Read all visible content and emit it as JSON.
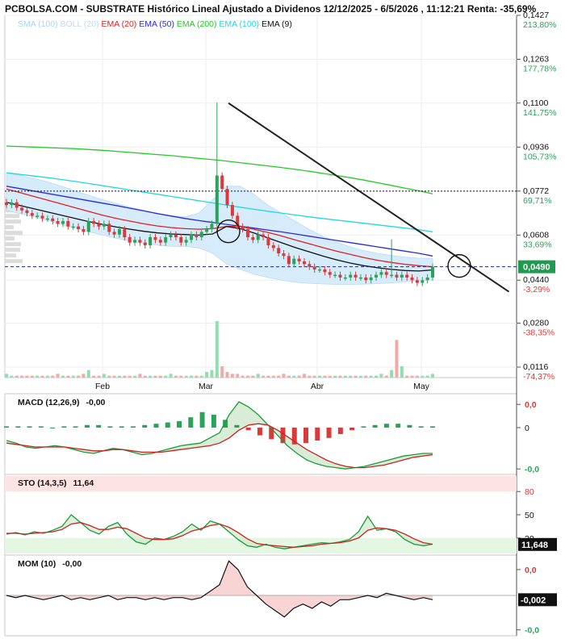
{
  "header": {
    "title": "PCBOLSA.COM - SUBSTRATE Histórico Lineal Ajustado a Dividenos 12/12/2025 - 6/5/2026 , 11:12:21 Renta: -35,69%"
  },
  "legend": [
    {
      "label": "SMA (100)",
      "color": "#a9d3f0"
    },
    {
      "label": "BOLL (20)",
      "color": "#c8d6e2"
    },
    {
      "label": "EMA (20)",
      "color": "#e02020"
    },
    {
      "label": "EMA (50)",
      "color": "#2b2bd6"
    },
    {
      "label": "EMA (200)",
      "color": "#22cc22"
    },
    {
      "label": "EMA (100)",
      "color": "#22d8e0"
    },
    {
      "label": "EMA (9)",
      "color": "#111111"
    }
  ],
  "colors": {
    "up": "#2aa35a",
    "down": "#d93a3a",
    "volume_up": "#8fe0b0",
    "volume_down": "#f4a9a9",
    "boll_fill": "#d6ecfb",
    "trendline": "#222222",
    "pct_positive": "#2aa35a",
    "pct_negative": "#d93a3a",
    "current_badge": "#1f9a4f"
  },
  "chart_data": [
    {
      "type": "candlestick",
      "title": "PCBOLSA.COM - SUBSTRATE Histórico Lineal Ajustado a Dividenos 12/12/2025 - 6/5/2026 , 11:12:21 Renta: -35,69%",
      "y_ticks": [
        {
          "price": "0,1427",
          "pct": "213,80%"
        },
        {
          "price": "0,1263",
          "pct": "177,78%"
        },
        {
          "price": "0,1100",
          "pct": "141,75%"
        },
        {
          "price": "0,0936",
          "pct": "105,73%"
        },
        {
          "price": "0,0772",
          "pct": "69,71%"
        },
        {
          "price": "0,0608",
          "pct": "33,69%"
        },
        {
          "price": "0,0440",
          "pct": "-3,29%"
        },
        {
          "price": "0,0280",
          "pct": "-38,35%"
        },
        {
          "price": "0,0116",
          "pct": "-74,37%"
        }
      ],
      "ylim": [
        0.0116,
        0.1427
      ],
      "x_labels": [
        "Feb",
        "Mar",
        "Abr",
        "May"
      ],
      "current_price": "0,0490",
      "reference_line": 0.0772,
      "trendline": [
        {
          "x": 0.437,
          "y": 0.11
        },
        {
          "x": 0.985,
          "y": 0.0397
        }
      ],
      "highlight_circles": [
        {
          "x": 0.437,
          "y": 0.0622
        },
        {
          "x": 0.888,
          "y": 0.0493
        }
      ],
      "close": [
        0.072,
        0.073,
        0.071,
        0.07,
        0.069,
        0.068,
        0.068,
        0.067,
        0.067,
        0.066,
        0.065,
        0.066,
        0.064,
        0.064,
        0.063,
        0.062,
        0.066,
        0.065,
        0.064,
        0.065,
        0.062,
        0.061,
        0.063,
        0.06,
        0.058,
        0.059,
        0.058,
        0.057,
        0.06,
        0.059,
        0.058,
        0.06,
        0.061,
        0.06,
        0.058,
        0.059,
        0.061,
        0.06,
        0.062,
        0.063,
        0.065,
        0.083,
        0.078,
        0.072,
        0.068,
        0.064,
        0.063,
        0.06,
        0.059,
        0.061,
        0.06,
        0.057,
        0.056,
        0.054,
        0.053,
        0.05,
        0.052,
        0.051,
        0.05,
        0.049,
        0.048,
        0.048,
        0.047,
        0.046,
        0.046,
        0.045,
        0.045,
        0.046,
        0.045,
        0.045,
        0.044,
        0.045,
        0.046,
        0.047,
        0.046,
        0.046,
        0.045,
        0.046,
        0.045,
        0.044,
        0.043,
        0.044,
        0.045,
        0.049
      ],
      "ema_200": [
        0.094,
        0.0938,
        0.0936,
        0.0934,
        0.0932,
        0.093,
        0.0927,
        0.0924,
        0.092,
        0.0916,
        0.0912,
        0.0908,
        0.0904,
        0.0899,
        0.0894,
        0.0889,
        0.0884,
        0.0878,
        0.0872,
        0.0866,
        0.086,
        0.0853,
        0.0846,
        0.0838,
        0.083,
        0.0822,
        0.0813,
        0.0803,
        0.0793,
        0.0783,
        0.0773,
        0.0762
      ],
      "ema_100": [
        0.084,
        0.0834,
        0.0828,
        0.0822,
        0.0815,
        0.0808,
        0.08,
        0.0792,
        0.0784,
        0.0776,
        0.0768,
        0.076,
        0.0752,
        0.0744,
        0.0736,
        0.0728,
        0.072,
        0.0712,
        0.0704,
        0.0697,
        0.069,
        0.0683,
        0.0676,
        0.067,
        0.0664,
        0.0658,
        0.0652,
        0.0646,
        0.064,
        0.0634,
        0.0628,
        0.062
      ],
      "ema_50": [
        0.079,
        0.0781,
        0.0772,
        0.0763,
        0.0754,
        0.0745,
        0.0736,
        0.0727,
        0.0718,
        0.0708,
        0.0698,
        0.0688,
        0.0679,
        0.067,
        0.0662,
        0.0655,
        0.0648,
        0.0641,
        0.0634,
        0.0627,
        0.062,
        0.0612,
        0.0604,
        0.0596,
        0.0588,
        0.058,
        0.0572,
        0.0564,
        0.0556,
        0.0548,
        0.054,
        0.053
      ],
      "ema_20": [
        0.078,
        0.0766,
        0.0752,
        0.0738,
        0.0724,
        0.071,
        0.0696,
        0.0682,
        0.067,
        0.066,
        0.065,
        0.0642,
        0.0636,
        0.0632,
        0.063,
        0.0632,
        0.064,
        0.064,
        0.063,
        0.0618,
        0.0605,
        0.059,
        0.0576,
        0.0562,
        0.0548,
        0.0536,
        0.0524,
        0.0514,
        0.0506,
        0.0499,
        0.0494,
        0.049
      ],
      "ema_9": [
        0.073,
        0.0718,
        0.0706,
        0.0694,
        0.0682,
        0.067,
        0.0658,
        0.0648,
        0.0638,
        0.063,
        0.0622,
        0.0616,
        0.0612,
        0.061,
        0.0608,
        0.0612,
        0.064,
        0.0632,
        0.0616,
        0.0598,
        0.058,
        0.0562,
        0.0546,
        0.053,
        0.0516,
        0.0504,
        0.0494,
        0.0486,
        0.048,
        0.0476,
        0.0474,
        0.0478
      ],
      "boll_upper": [
        0.084,
        0.083,
        0.0818,
        0.0806,
        0.079,
        0.0772,
        0.0756,
        0.074,
        0.0726,
        0.0712,
        0.07,
        0.0688,
        0.068,
        0.0676,
        0.069,
        0.074,
        0.079,
        0.079,
        0.076,
        0.072,
        0.069,
        0.066,
        0.063,
        0.0604,
        0.0582,
        0.0564,
        0.055,
        0.054,
        0.0532,
        0.0526,
        0.0522,
        0.052
      ],
      "boll_lower": [
        0.07,
        0.0688,
        0.0676,
        0.0662,
        0.0648,
        0.0634,
        0.062,
        0.0608,
        0.0596,
        0.0586,
        0.0578,
        0.057,
        0.0566,
        0.0566,
        0.056,
        0.054,
        0.05,
        0.048,
        0.0462,
        0.045,
        0.044,
        0.0432,
        0.0428,
        0.0426,
        0.0424,
        0.0424,
        0.0425,
        0.0427,
        0.043,
        0.0434,
        0.0438,
        0.0442
      ],
      "volume": [
        2,
        1,
        1,
        1,
        1,
        1,
        1,
        1,
        1,
        1,
        2,
        1,
        1,
        1,
        1,
        2,
        4,
        1,
        1,
        2,
        1,
        1,
        1,
        1,
        1,
        1,
        2,
        1,
        1,
        1,
        1,
        1,
        2,
        1,
        1,
        1,
        1,
        1,
        1,
        3,
        4,
        30,
        6,
        3,
        2,
        2,
        1,
        1,
        1,
        2,
        1,
        1,
        1,
        1,
        2,
        1,
        1,
        1,
        2,
        1,
        1,
        1,
        1,
        1,
        1,
        1,
        1,
        1,
        1,
        1,
        1,
        1,
        1,
        2,
        1,
        4,
        20,
        6,
        1,
        1,
        1,
        1,
        1,
        2
      ]
    },
    {
      "type": "line",
      "title": "MACD (12,26,9)",
      "value_label": "-0,00",
      "y_ticks": [
        "0,0",
        "0",
        "-0,0"
      ],
      "macd": [
        -0.001,
        -0.0012,
        -0.0015,
        -0.0016,
        -0.0015,
        -0.0014,
        -0.0015,
        -0.0017,
        -0.0019,
        -0.002,
        -0.0018,
        -0.0016,
        -0.0017,
        -0.0019,
        -0.0021,
        -0.002,
        -0.0018,
        -0.0016,
        -0.0014,
        -0.0013,
        -0.0012,
        -0.0008,
        -0.0004,
        0.001,
        0.002,
        0.0016,
        0.001,
        0.0002,
        -0.0006,
        -0.0014,
        -0.002,
        -0.0025,
        -0.0028,
        -0.003,
        -0.0031,
        -0.0032,
        -0.0031,
        -0.003,
        -0.0028,
        -0.0026,
        -0.0024,
        -0.0022,
        -0.0021,
        -0.002,
        -0.002
      ],
      "signal": [
        -0.0012,
        -0.0013,
        -0.0014,
        -0.0015,
        -0.0015,
        -0.0015,
        -0.0015,
        -0.0016,
        -0.0017,
        -0.0018,
        -0.0018,
        -0.0017,
        -0.0017,
        -0.0018,
        -0.0019,
        -0.0019,
        -0.0019,
        -0.0018,
        -0.0017,
        -0.0016,
        -0.0015,
        -0.0014,
        -0.0012,
        -0.0008,
        -0.0002,
        0.0002,
        0.0003,
        0.0002,
        -0.0002,
        -0.0007,
        -0.0012,
        -0.0017,
        -0.0021,
        -0.0025,
        -0.0028,
        -0.003,
        -0.0031,
        -0.0031,
        -0.003,
        -0.0029,
        -0.0027,
        -0.0025,
        -0.0023,
        -0.0022,
        -0.0021
      ],
      "histogram": [
        0.0001,
        0.0001,
        0.0001,
        0.0001,
        0.0,
        0.0001,
        0.0001,
        0.0002,
        0.0002,
        0.0001,
        0.0001,
        0.0001,
        0.0002,
        0.0003,
        0.0004,
        0.0005,
        0.0008,
        0.0012,
        0.001,
        0.0006,
        0.0002,
        -0.0002,
        -0.0006,
        -0.0009,
        -0.0012,
        -0.0013,
        -0.0012,
        -0.001,
        -0.0008,
        -0.0005,
        -0.0002,
        0.0001,
        0.0002,
        0.0003,
        0.0003,
        0.0002,
        0.0001,
        0.0001
      ]
    },
    {
      "type": "line",
      "title": "STO (14,3,5)",
      "value_label": "11,64",
      "current_value": "11,648",
      "y_ticks": [
        "80",
        "50",
        "20"
      ],
      "ylim": [
        0,
        100
      ],
      "k": [
        25,
        27,
        24,
        28,
        26,
        30,
        35,
        50,
        40,
        30,
        25,
        35,
        40,
        25,
        15,
        12,
        20,
        18,
        22,
        28,
        38,
        30,
        42,
        38,
        28,
        18,
        10,
        8,
        12,
        8,
        6,
        8,
        10,
        12,
        14,
        13,
        15,
        18,
        28,
        48,
        30,
        32,
        28,
        18,
        12,
        10,
        12
      ],
      "d": [
        26,
        26,
        25,
        26,
        27,
        28,
        31,
        38,
        40,
        36,
        31,
        31,
        34,
        32,
        26,
        20,
        18,
        18,
        19,
        23,
        29,
        32,
        36,
        38,
        34,
        27,
        19,
        13,
        11,
        10,
        9,
        8,
        9,
        10,
        12,
        13,
        14,
        16,
        20,
        30,
        33,
        32,
        30,
        25,
        19,
        14,
        12
      ]
    },
    {
      "type": "line",
      "title": "MOM (10)",
      "value_label": "-0,00",
      "current_value": "-0,002",
      "y_ticks": [
        "0,0",
        "-0,0"
      ],
      "values": [
        0.0,
        -0.001,
        0.0,
        -0.001,
        -0.002,
        -0.001,
        0.0,
        -0.002,
        -0.001,
        -0.002,
        -0.001,
        0.0,
        -0.002,
        -0.001,
        -0.001,
        -0.002,
        -0.001,
        -0.002,
        -0.001,
        -0.001,
        -0.002,
        -0.001,
        0.002,
        0.005,
        0.016,
        0.012,
        0.004,
        0.0,
        -0.004,
        -0.007,
        -0.01,
        -0.006,
        -0.004,
        -0.006,
        -0.003,
        -0.005,
        -0.002,
        -0.002,
        -0.001,
        0.0,
        -0.001,
        0.001,
        0.0,
        -0.001,
        -0.002,
        -0.001,
        -0.002
      ]
    }
  ]
}
